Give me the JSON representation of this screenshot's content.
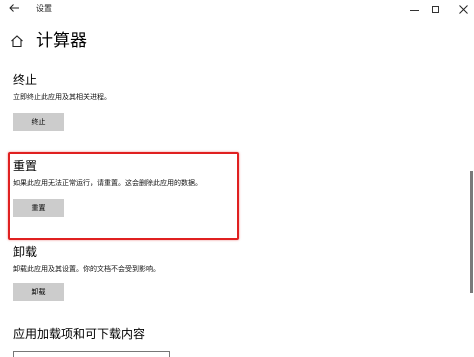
{
  "window": {
    "title": "设置"
  },
  "header": {
    "title": "计算器"
  },
  "terminate": {
    "title": "终止",
    "description": "立即终止此应用及其相关进程。",
    "button_label": "终止"
  },
  "reset": {
    "title": "重置",
    "description": "如果此应用无法正常运行，请重置。这会删除此应用的数据。",
    "button_label": "重置"
  },
  "uninstall": {
    "title": "卸载",
    "description": "卸载此应用及其设置。你的文档不会受到影响。",
    "button_label": "卸载"
  },
  "addons": {
    "title": "应用加载项和可下载内容"
  },
  "colors": {
    "highlight_border": "#e02020",
    "button_background": "#cccccc",
    "scrollbar_thumb": "#7a7a7a"
  },
  "icons": {
    "back": "back-arrow-icon",
    "home": "home-icon",
    "minimize": "minimize-icon",
    "maximize": "maximize-icon",
    "close": "close-icon"
  }
}
